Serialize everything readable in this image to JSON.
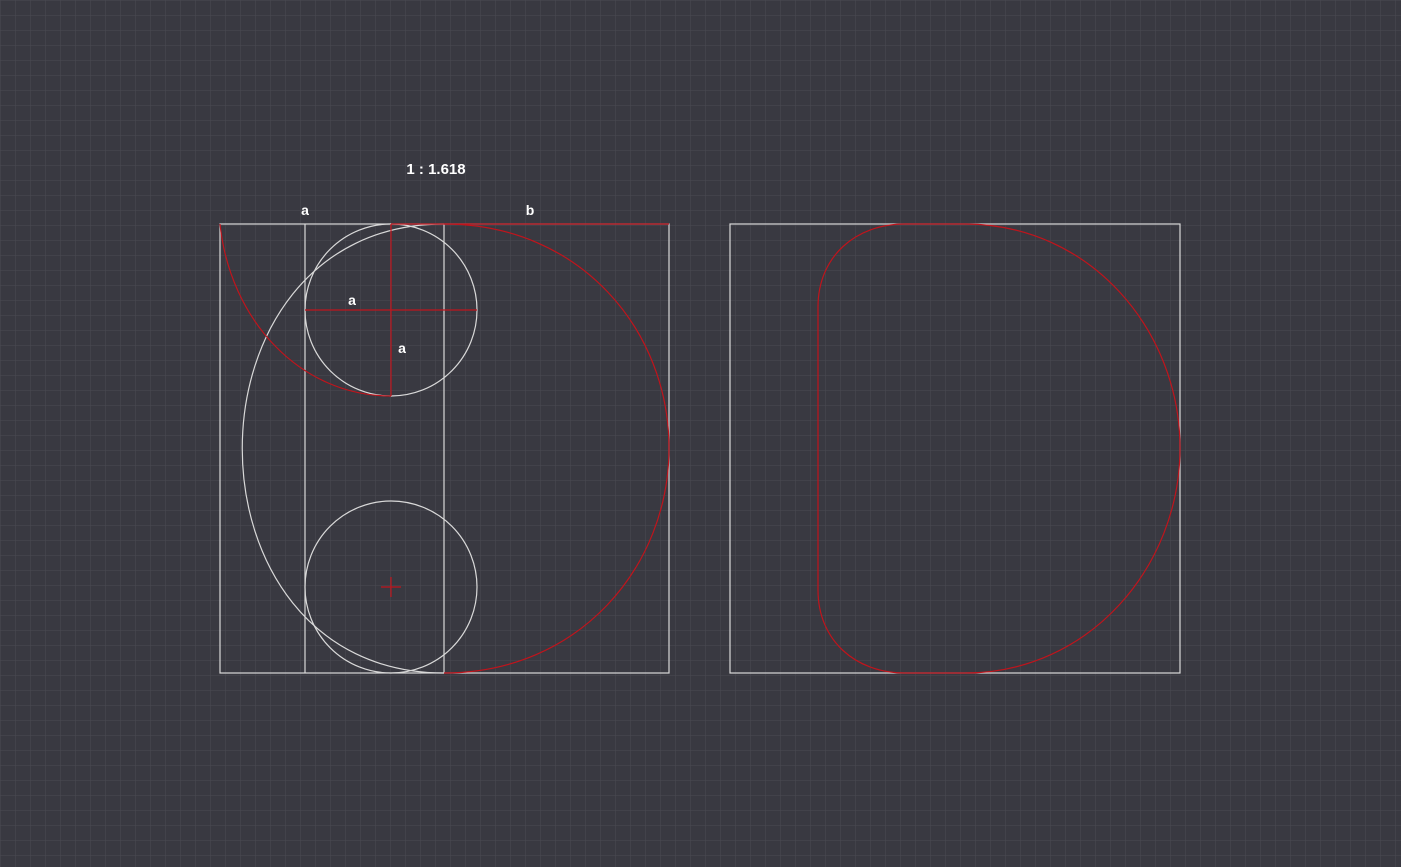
{
  "ratio_label": "1 : 1.618",
  "labels": {
    "a_top": "a",
    "b_top": "b",
    "a_horizontal": "a",
    "a_vertical": "a"
  },
  "colors": {
    "background": "#393941",
    "grid": "#4a4a52",
    "construction_line": "#d9d9d9",
    "accent": "#c0141c",
    "label": "#ffffff"
  }
}
